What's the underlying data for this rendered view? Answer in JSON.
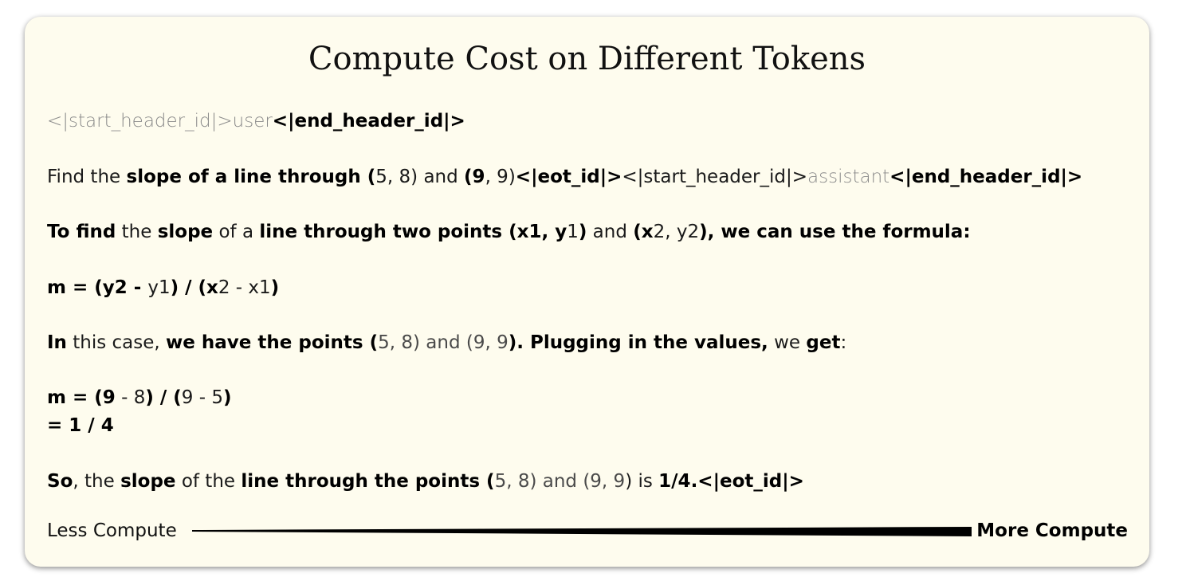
{
  "title": "Compute Cost on Different Tokens",
  "lines": [
    [
      {
        "t": "<|start_header_id|>user",
        "w": 0
      },
      {
        "t": "<|end_header_id|>",
        "w": 3
      }
    ],
    [
      {
        "t": "Find the ",
        "w": 2
      },
      {
        "t": "slope of a line through (",
        "w": 3
      },
      {
        "t": "5",
        "w": 2
      },
      {
        "t": ", 8) and ",
        "w": 2
      },
      {
        "t": "(9",
        "w": 3
      },
      {
        "t": ", 9)",
        "w": 2
      },
      {
        "t": "<|eot_id|>",
        "w": 3
      },
      {
        "t": "<|start_header_id|>",
        "w": 2
      },
      {
        "t": "assistant",
        "w": 0
      },
      {
        "t": "<|end_header_id|>",
        "w": 3
      }
    ],
    [
      {
        "t": "To find",
        "w": 3
      },
      {
        "t": " the ",
        "w": 2
      },
      {
        "t": "slope",
        "w": 3
      },
      {
        "t": " of a ",
        "w": 2
      },
      {
        "t": "line through two points (x1, y",
        "w": 3
      },
      {
        "t": "1",
        "w": 2
      },
      {
        "t": ")",
        "w": 3
      },
      {
        "t": " and ",
        "w": 2
      },
      {
        "t": "(x",
        "w": 3
      },
      {
        "t": "2, y2",
        "w": 2
      },
      {
        "t": "), we can use the formula:",
        "w": 3
      }
    ],
    [
      {
        "t": "m = (y2 - ",
        "w": 3
      },
      {
        "t": "y1",
        "w": 2
      },
      {
        "t": ") / (x",
        "w": 3
      },
      {
        "t": "2 - x1",
        "w": 2
      },
      {
        "t": ")",
        "w": 3
      }
    ],
    [
      {
        "t": "In",
        "w": 3
      },
      {
        "t": " this case, ",
        "w": 2
      },
      {
        "t": "we have the points (",
        "w": 3
      },
      {
        "t": "5, 8) and (9, 9",
        "w": 1
      },
      {
        "t": "). Plugging in the values,",
        "w": 3
      },
      {
        "t": " we ",
        "w": 2
      },
      {
        "t": "get",
        "w": 3
      },
      {
        "t": ":",
        "w": 2
      }
    ],
    [
      {
        "t": "m = (9",
        "w": 3
      },
      {
        "t": " - 8",
        "w": 2
      },
      {
        "t": ") / (",
        "w": 3
      },
      {
        "t": "9 - 5",
        "w": 2
      },
      {
        "t": ")",
        "w": 3
      }
    ],
    [
      {
        "t": "= 1 / 4",
        "w": 3
      }
    ],
    [
      {
        "t": "So",
        "w": 3
      },
      {
        "t": ", the ",
        "w": 2
      },
      {
        "t": "slope",
        "w": 3
      },
      {
        "t": " of the ",
        "w": 2
      },
      {
        "t": "line through the points (",
        "w": 3
      },
      {
        "t": "5, 8) and (9, 9",
        "w": 1
      },
      {
        "t": ") is ",
        "w": 2
      },
      {
        "t": "1/4.<|eot_id|>",
        "w": 3
      }
    ]
  ],
  "legend": {
    "less": "Less Compute",
    "more": "More Compute"
  }
}
